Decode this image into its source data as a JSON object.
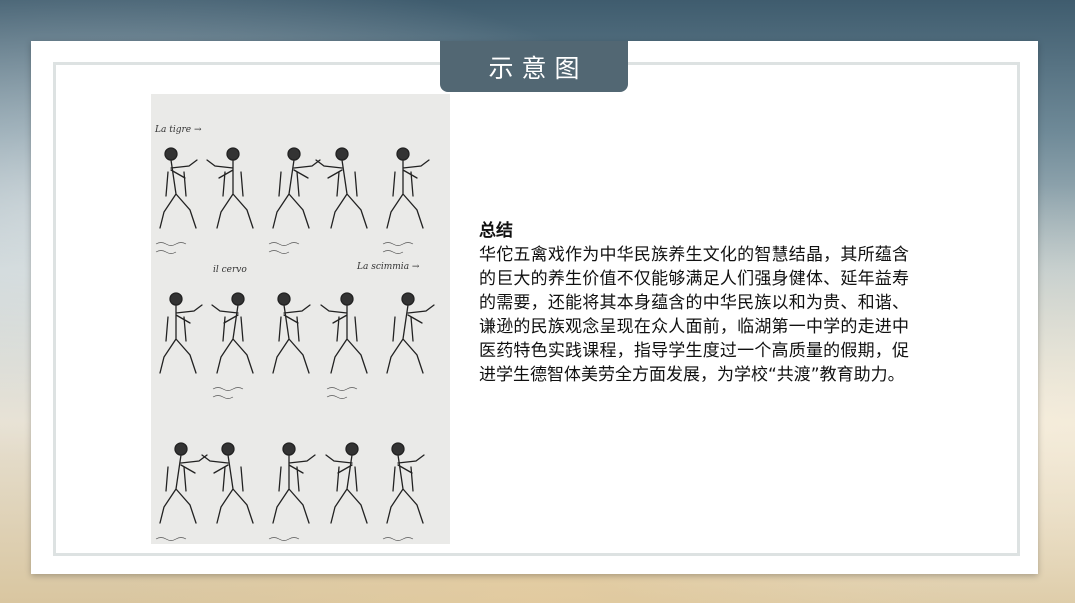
{
  "slide": {
    "tab_title": "示意图",
    "summary_title": "总结",
    "summary_body": "华佗五禽戏作为中华民族养生文化的智慧结晶，其所蕴含的巨大的养生价值不仅能够满足人们强身健体、延年益寿的需要，还能将其本身蕴含的中华民族以和为贵、和谐、谦逊的民族观念呈现在众人面前，临湖第一中学的走进中医药特色实践课程，指导学生度过一个高质量的假期，促进学生德智体美劳全方面发展，为学校“共渡”教育助力。"
  },
  "illustration": {
    "labels": {
      "tiger": "La tigre →",
      "deer": "il cervo",
      "monkey": "La scimmia →"
    }
  }
}
